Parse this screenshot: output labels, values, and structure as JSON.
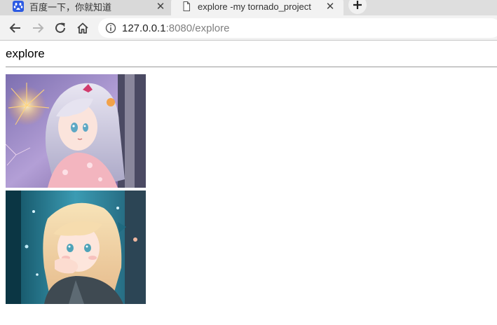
{
  "browser": {
    "tabs": [
      {
        "title": "百度一下，你就知道",
        "favicon": "baidu-paw-icon",
        "active": false
      },
      {
        "title": "explore -my tornado_project",
        "favicon": "document-icon",
        "active": true
      }
    ],
    "tab_close_glyph": "✕",
    "address": {
      "host": "127.0.0.1",
      "rest": ":8080/explore"
    }
  },
  "page": {
    "heading": "explore",
    "images": [
      {
        "name": "anime-girl-fireworks-image"
      },
      {
        "name": "anime-girl-blonde-image"
      }
    ]
  },
  "colors": {
    "baidu_blue": "#2d5be3",
    "toolbar": "#f2f2f2",
    "tabstrip": "#dedede"
  }
}
